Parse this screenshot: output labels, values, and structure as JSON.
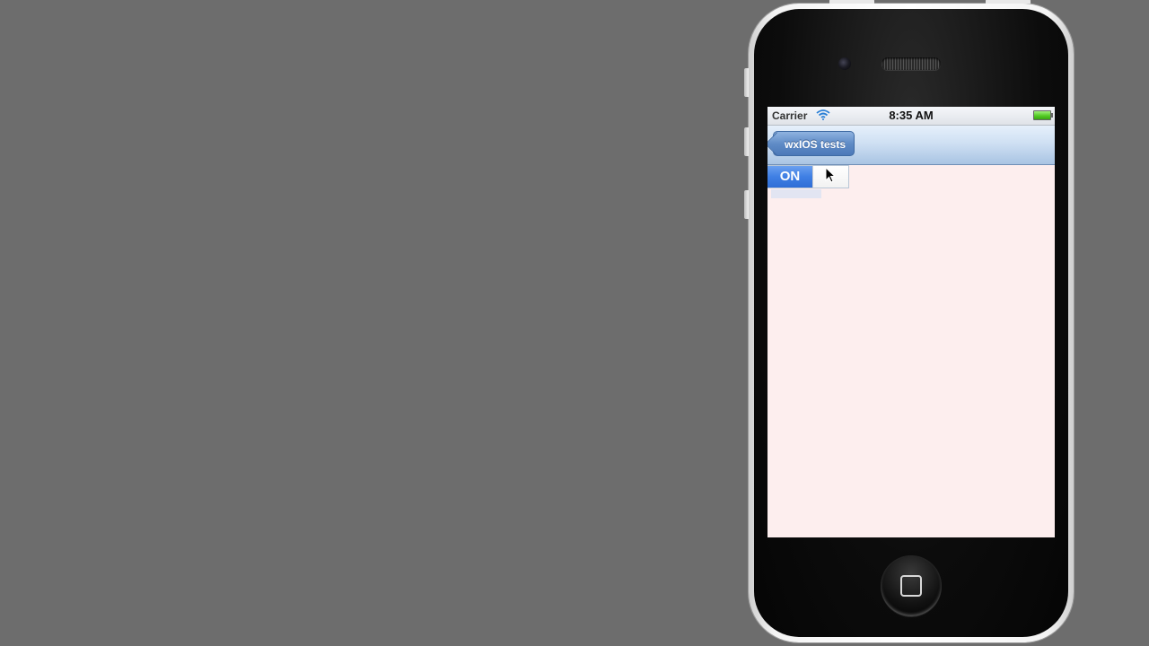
{
  "status_bar": {
    "carrier": "Carrier",
    "time": "8:35 AM",
    "wifi_icon": "wifi-icon",
    "battery_icon": "battery-icon",
    "battery_color": "#4fc81f"
  },
  "nav_bar": {
    "back_label": "wxIOS tests"
  },
  "toggle": {
    "state_label": "ON",
    "accent": "#3f7fe4"
  },
  "colors": {
    "desktop_bg": "#6d6d6d",
    "screen_bg": "#fdeeee",
    "nav_bar": "#cfe0f3"
  }
}
